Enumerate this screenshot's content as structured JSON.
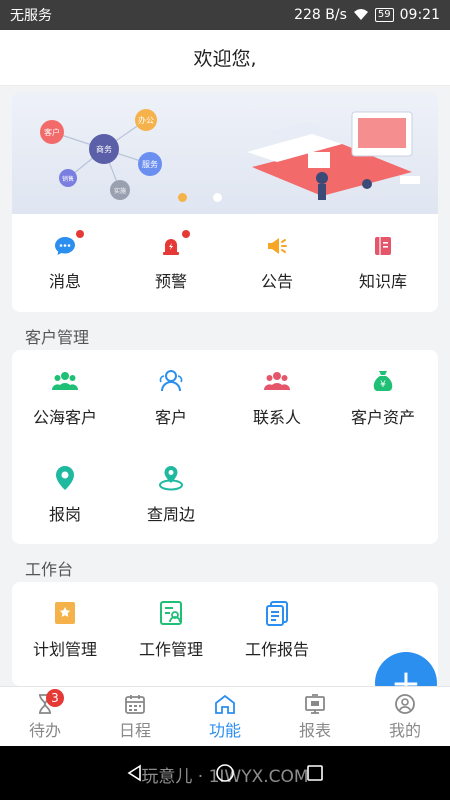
{
  "status": {
    "carrier": "无服务",
    "speed": "228 B/s",
    "battery": "59",
    "time": "09:21"
  },
  "header": {
    "title": "欢迎您,"
  },
  "banner": {
    "bubbles": [
      "客户",
      "商务",
      "办公",
      "服务",
      "销售",
      "实施"
    ],
    "colors": {
      "accent": "#f6b24a",
      "platform": "#f26a6a"
    }
  },
  "quick": [
    {
      "label": "消息",
      "icon": "chat-icon",
      "color": "#2b8ff0",
      "dot": true
    },
    {
      "label": "预警",
      "icon": "alarm-icon",
      "color": "#e53935",
      "dot": true
    },
    {
      "label": "公告",
      "icon": "megaphone-icon",
      "color": "#f6a623",
      "dot": false
    },
    {
      "label": "知识库",
      "icon": "book-icon",
      "color": "#e5566b",
      "dot": false
    }
  ],
  "customer": {
    "title": "客户管理",
    "items": [
      {
        "label": "公海客户",
        "icon": "group-icon",
        "color": "#1fbf76"
      },
      {
        "label": "客户",
        "icon": "people-outline-icon",
        "color": "#2b8ff0"
      },
      {
        "label": "联系人",
        "icon": "contacts-icon",
        "color": "#e5566b"
      },
      {
        "label": "客户资产",
        "icon": "money-bag-icon",
        "color": "#1fbf76"
      },
      {
        "label": "报岗",
        "icon": "location-pin-icon",
        "color": "#1fb9a0"
      },
      {
        "label": "查周边",
        "icon": "nearby-icon",
        "color": "#1fb9a0"
      }
    ]
  },
  "workbench": {
    "title": "工作台",
    "items": [
      {
        "label": "计划管理",
        "icon": "plan-icon",
        "color": "#f6b24a"
      },
      {
        "label": "工作管理",
        "icon": "work-manage-icon",
        "color": "#1fbf76"
      },
      {
        "label": "工作报告",
        "icon": "report-doc-icon",
        "color": "#2b8ff0"
      }
    ]
  },
  "fab": {
    "label": "+"
  },
  "tabs": [
    {
      "label": "待办",
      "badge": "3"
    },
    {
      "label": "日程"
    },
    {
      "label": "功能"
    },
    {
      "label": "报表"
    },
    {
      "label": "我的"
    }
  ],
  "watermark": "玩意儿 · 1IWYX.COM"
}
